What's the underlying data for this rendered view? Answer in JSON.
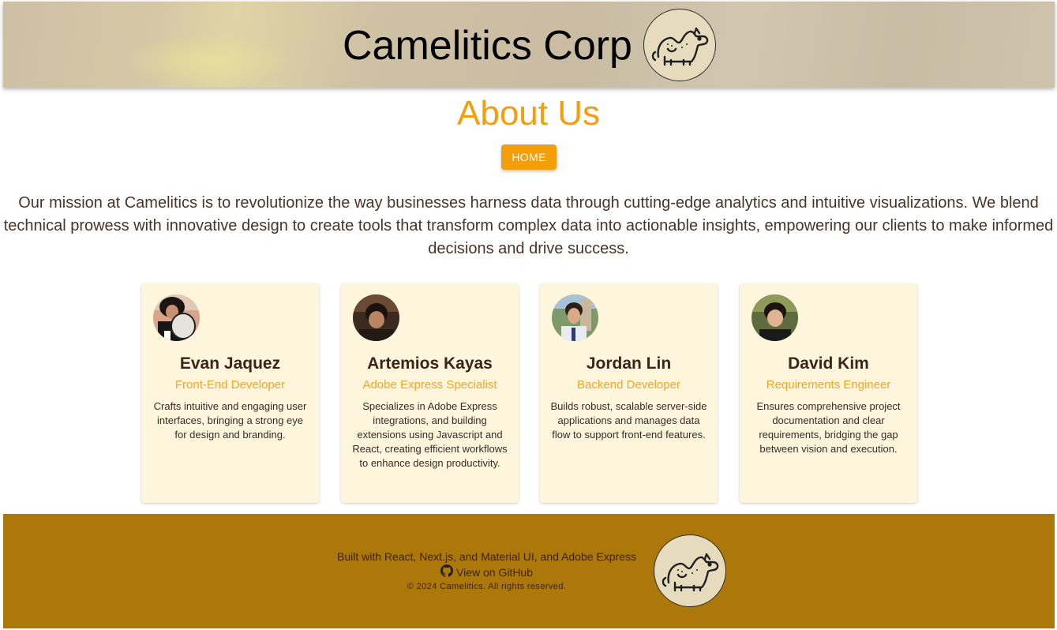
{
  "header": {
    "title": "Camelitics Corp",
    "logo": "camel-logo"
  },
  "about": {
    "title": "About Us",
    "home_label": "HOME",
    "mission": "Our mission at Camelitics is to revolutionize the way businesses harness data through cutting-edge analytics and intuitive visualizations. We blend technical prowess with innovative design to create tools that transform complex data into actionable insights, empowering our clients to make informed decisions and drive success."
  },
  "team": [
    {
      "name": "Evan Jaquez",
      "role": "Front-End Developer",
      "description": "Crafts intuitive and engaging user interfaces, bringing a strong eye for design and branding."
    },
    {
      "name": "Artemios Kayas",
      "role": "Adobe Express Specialist",
      "description": "Specializes in Adobe Express integrations, and building extensions using Javascript and React, creating efficient workflows to enhance design productivity."
    },
    {
      "name": "Jordan Lin",
      "role": "Backend Developer",
      "description": "Builds robust, scalable server-side applications and manages data flow to support front-end features."
    },
    {
      "name": "David Kim",
      "role": "Requirements Engineer",
      "description": "Ensures comprehensive project documentation and clear requirements, bridging the gap between vision and execution."
    }
  ],
  "footer": {
    "built_with": "Built with React, Next.js, and Material UI, and Adobe Express",
    "github_label": "View on GitHub",
    "github_icon": "github-icon",
    "copyright": "© 2024 Camelitics. All rights reserved."
  },
  "colors": {
    "accent": "#f59e0b",
    "footer_bg": "#ad780a",
    "card_bg": "#fdf5dc",
    "text_brown": "#4a3328"
  }
}
